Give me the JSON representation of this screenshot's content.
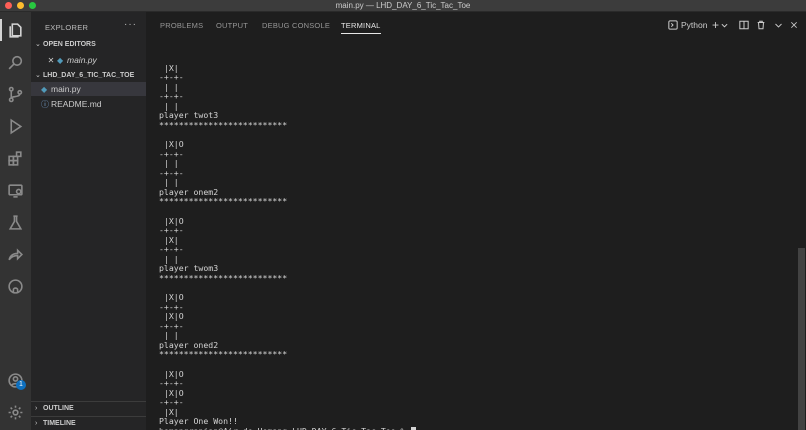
{
  "window": {
    "title": "main.py — LHD_DAY_6_Tic_Tac_Toe"
  },
  "activity_bar": {
    "items": [
      {
        "name": "explorer-icon",
        "active": true
      },
      {
        "name": "search-icon"
      },
      {
        "name": "source-control-icon"
      },
      {
        "name": "run-debug-icon"
      },
      {
        "name": "extensions-icon"
      },
      {
        "name": "remote-explorer-icon"
      },
      {
        "name": "testing-icon"
      },
      {
        "name": "live-share-icon"
      },
      {
        "name": "github-icon"
      }
    ],
    "accounts_badge": "1"
  },
  "sidebar": {
    "title": "EXPLORER",
    "more": "···",
    "open_editors": {
      "label": "OPEN EDITORS",
      "files": [
        {
          "name": "main.py",
          "close": "✕"
        }
      ]
    },
    "folder": {
      "label": "LHD_DAY_6_TIC_TAC_TOE",
      "files": [
        {
          "name": "main.py",
          "icon": "python-file-icon"
        },
        {
          "name": "README.md",
          "icon": "info-icon"
        }
      ]
    },
    "outline_label": "OUTLINE",
    "timeline_label": "TIMELINE"
  },
  "panel": {
    "tabs": [
      "PROBLEMS",
      "OUTPUT",
      "DEBUG CONSOLE",
      "TERMINAL"
    ],
    "active_tab": "TERMINAL",
    "terminal_name": "Python",
    "add": "+"
  },
  "terminal": {
    "lines": [
      "",
      " |X|",
      "-+-+-",
      " | |",
      "-+-+-",
      " | |",
      "player twot3",
      "**************************",
      "",
      " |X|O",
      "-+-+-",
      " | |",
      "-+-+-",
      " | |",
      "player onem2",
      "**************************",
      "",
      " |X|O",
      "-+-+-",
      " |X|",
      "-+-+-",
      " | |",
      "player twom3",
      "**************************",
      "",
      " |X|O",
      "-+-+-",
      " |X|O",
      "-+-+-",
      " | |",
      "player oned2",
      "**************************",
      "",
      " |X|O",
      "-+-+-",
      " |X|O",
      "-+-+-",
      " |X|",
      "Player One Won!!"
    ],
    "prompt": "hemangranjan@Air-de-Hemang LHD_DAY_6_Tic_Tac_Toe % "
  },
  "colors": {
    "activity_bar": "#333333",
    "sidebar": "#252526",
    "editor": "#1e1e1e",
    "accent_badge": "#0e70c0"
  }
}
